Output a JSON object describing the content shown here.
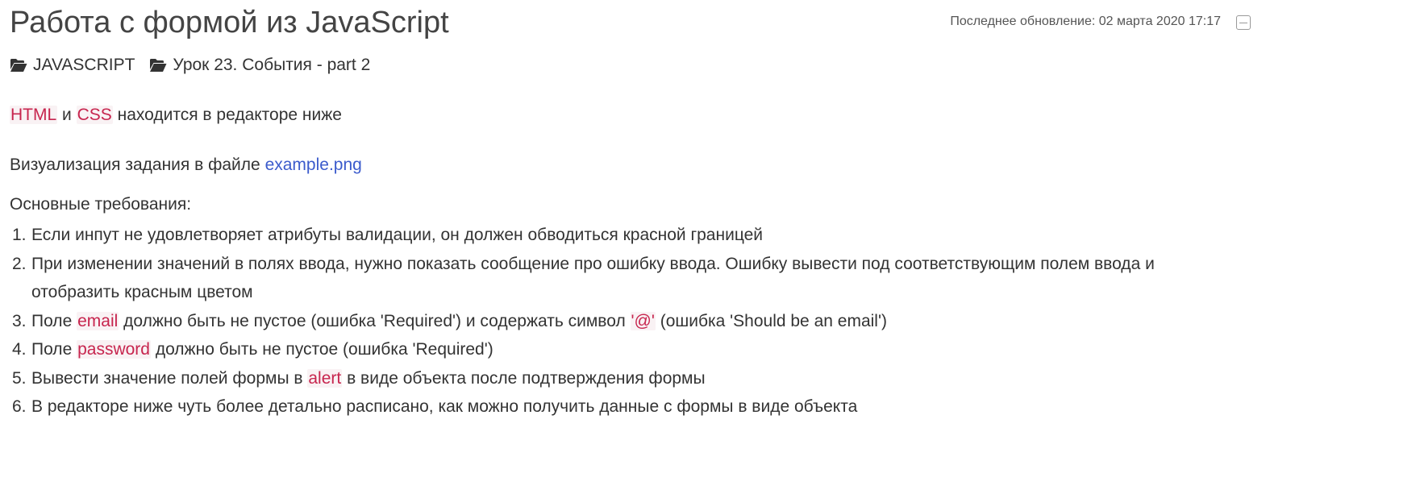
{
  "header": {
    "title": "Работа с формой из JavaScript",
    "updated_label": "Последнее обновление: 02 марта 2020 17:17"
  },
  "breadcrumbs": [
    {
      "icon": "folder-open-icon",
      "label": "JAVASCRIPT"
    },
    {
      "icon": "folder-open-icon",
      "label": "Урок 23. События - part 2"
    }
  ],
  "content": {
    "intro": {
      "code1": "HTML",
      "text1": " и ",
      "code2": "CSS",
      "text2": " находится в редакторе ниже"
    },
    "visual": {
      "text": "Визуализация задания в файле ",
      "link": "example.png"
    },
    "requirements_heading": "Основные требования:",
    "requirements": [
      {
        "num": "1.",
        "t1": "Если инпут не удовлетворяет атрибуты валидации, он должен обводиться красной границей"
      },
      {
        "num": "2.",
        "t1": "При изменении значений в полях ввода, нужно показать сообщение про ошибку ввода. Ошибку вывести под соответствующим полем ввода и отобразить красным цветом"
      },
      {
        "num": "3.",
        "t1": "Поле ",
        "c1": "email",
        "t2": " должно быть не пустое (ошибка 'Required') и содержать символ ",
        "c2": "'@'",
        "t3": " (ошибка 'Should be an email')"
      },
      {
        "num": "4.",
        "t1": "Поле ",
        "c1": "password",
        "t2": " должно быть не пустое (ошибка 'Required')"
      },
      {
        "num": "5.",
        "t1": "Вывести значение полей формы в ",
        "c1": "alert",
        "t2": " в виде объекта после подтверждения формы"
      },
      {
        "num": "6.",
        "t1": "В редакторе ниже чуть более детально расписано, как можно получить данные с формы в виде объекта"
      }
    ]
  },
  "colors": {
    "text": "#333333",
    "code_text": "#c7254e",
    "code_bg": "#f9f2f4",
    "link": "#3b5bcc"
  }
}
